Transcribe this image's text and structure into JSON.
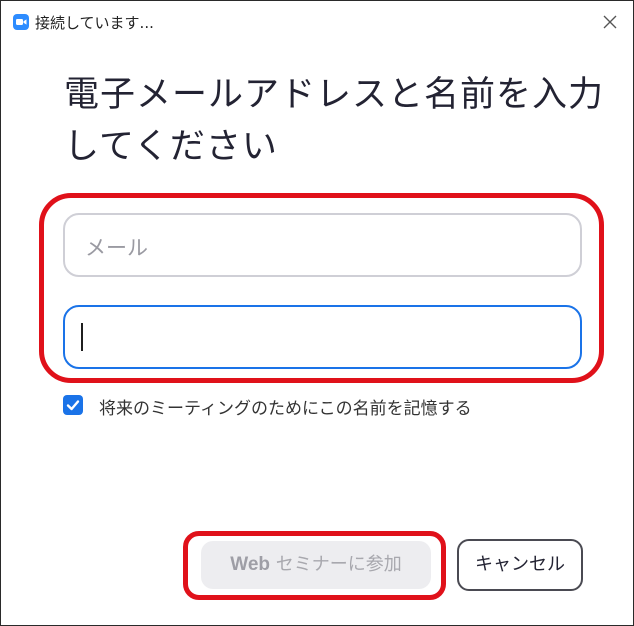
{
  "window": {
    "title": "接続しています...",
    "accent_color": "#2d8cff"
  },
  "dialog": {
    "heading_line1": "電子メールアドレスと名前を入力",
    "heading_line2": "してください",
    "email": {
      "placeholder": "メール",
      "value": ""
    },
    "name": {
      "value": "",
      "focused": true
    },
    "remember": {
      "label": "将来のミーティングのためにこの名前を記憶する",
      "checked": true
    },
    "join_button": {
      "prefix": "Web",
      "label": " セミナーに参加",
      "enabled": false
    },
    "cancel_button": {
      "label": "キャンセル"
    },
    "highlight_color": "#e0111a"
  }
}
